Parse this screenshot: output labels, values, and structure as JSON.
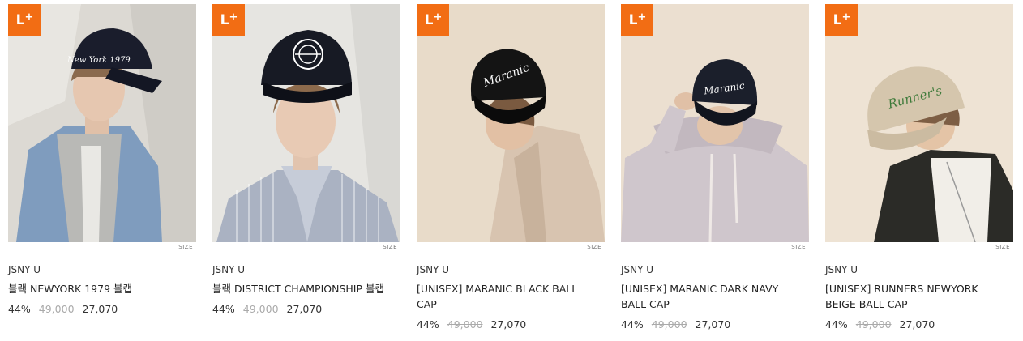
{
  "badge": {
    "letter": "L",
    "plus": "+"
  },
  "size_label": "SIZE",
  "products": [
    {
      "brand": "JSNY U",
      "name": "블랙 NEWYORK 1979 볼캡",
      "discount": "44%",
      "original_price": "49,000",
      "sale_price": "27,070",
      "cap_text": "New York 1979",
      "bg_color": "#d9d6d0",
      "cap_color": "#1a1d2c"
    },
    {
      "brand": "JSNY U",
      "name": "블랙 DISTRICT CHAMPIONSHIP 볼캡",
      "discount": "44%",
      "original_price": "49,000",
      "sale_price": "27,070",
      "cap_text": "",
      "bg_color": "#e4e3df",
      "cap_color": "#171a24"
    },
    {
      "brand": "JSNY U",
      "name": "[UNISEX] MARANIC BLACK BALL CAP",
      "discount": "44%",
      "original_price": "49,000",
      "sale_price": "27,070",
      "cap_text": "Maranic",
      "bg_color": "#e9dccb",
      "cap_color": "#141414"
    },
    {
      "brand": "JSNY U",
      "name": "[UNISEX] MARANIC DARK NAVY BALL CAP",
      "discount": "44%",
      "original_price": "49,000",
      "sale_price": "27,070",
      "cap_text": "Maranic",
      "bg_color": "#eadfd0",
      "cap_color": "#1b1f2b"
    },
    {
      "brand": "JSNY U",
      "name": "[UNISEX] RUNNERS NEWYORK BEIGE BALL CAP",
      "discount": "44%",
      "original_price": "49,000",
      "sale_price": "27,070",
      "cap_text": "Runner's",
      "bg_color": "#ede2d3",
      "cap_color": "#d5c6ad"
    }
  ]
}
